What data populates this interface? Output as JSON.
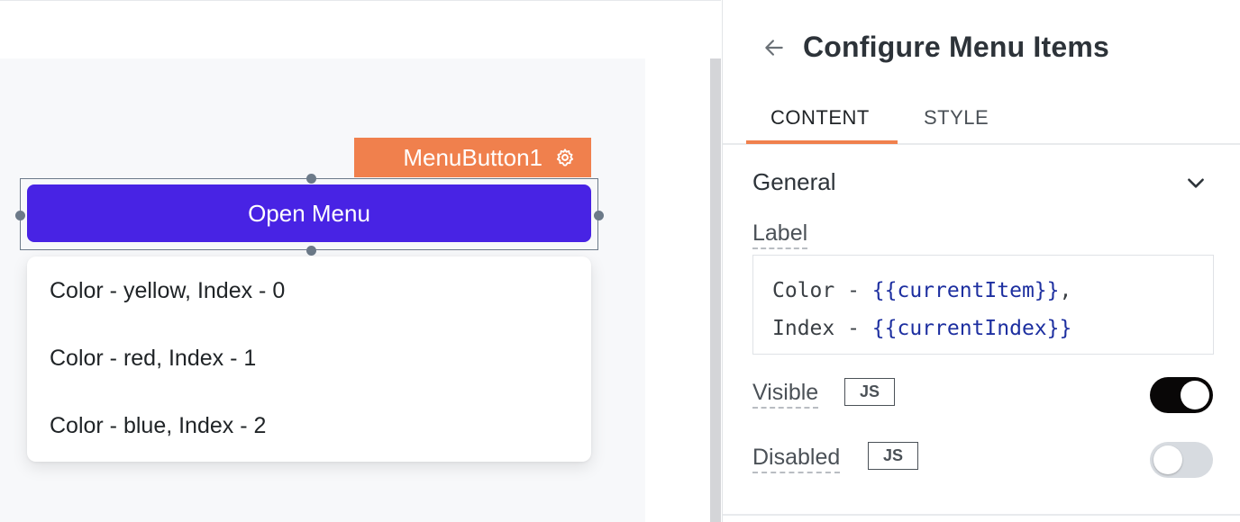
{
  "canvas": {
    "widget_tag": "MenuButton1",
    "button_label": "Open Menu",
    "menu_items": [
      {
        "label": "Color - yellow, Index - 0"
      },
      {
        "label": "Color - red, Index - 1"
      },
      {
        "label": "Color - blue, Index - 2"
      }
    ]
  },
  "pane": {
    "title": "Configure Menu Items",
    "tabs": [
      {
        "label": "CONTENT",
        "active": true
      },
      {
        "label": "STYLE",
        "active": false
      }
    ],
    "section": {
      "title": "General",
      "label_field": {
        "label": "Label",
        "line1_prefix": "Color - ",
        "line1_expr": "{{currentItem}}",
        "line1_suffix": ",",
        "line2_prefix": "Index - ",
        "line2_expr": "{{currentIndex}}"
      },
      "visible": {
        "label": "Visible",
        "js_badge": "JS",
        "value": true
      },
      "disabled": {
        "label": "Disabled",
        "js_badge": "JS",
        "value": false
      }
    }
  },
  "colors": {
    "accent": "#f0804d",
    "button": "#4823e4",
    "toggle_on": "#090707",
    "toggle_off": "#d7dbe0",
    "code_expr": "#1d2fa0"
  },
  "icons": {
    "back": "arrow-left-icon",
    "settings": "gear-icon",
    "collapse": "chevron-down-icon"
  }
}
